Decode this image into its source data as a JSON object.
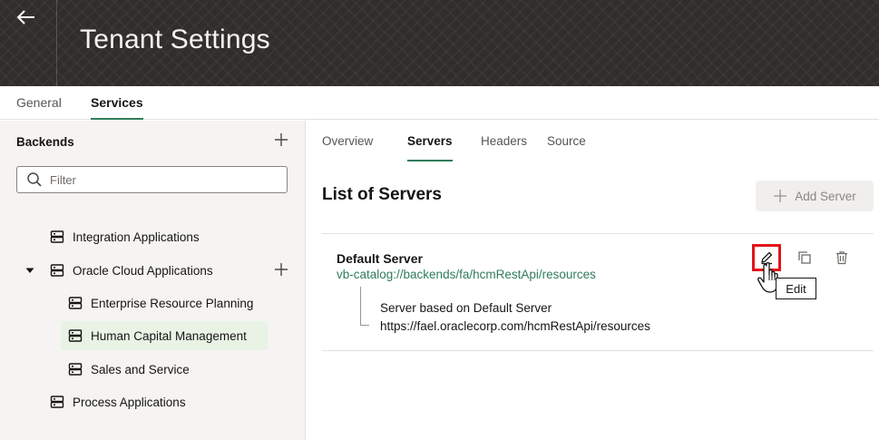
{
  "header": {
    "title": "Tenant Settings",
    "background": "#312d2a"
  },
  "top_tabs": [
    {
      "label": "General",
      "active": false
    },
    {
      "label": "Services",
      "active": true
    }
  ],
  "backends": {
    "title": "Backends",
    "filter_placeholder": "Filter",
    "items": [
      {
        "label": "Integration Applications",
        "level": 0,
        "expandable": false,
        "selected": false,
        "icon": "server-stack-icon"
      },
      {
        "label": "Oracle Cloud Applications",
        "level": 0,
        "expandable": true,
        "expanded": true,
        "selected": false,
        "icon": "server-stack-icon"
      },
      {
        "label": "Enterprise Resource Planning",
        "level": 1,
        "selected": false,
        "icon": "server-stack-icon"
      },
      {
        "label": "Human Capital Management",
        "level": 1,
        "selected": true,
        "icon": "server-stack-icon"
      },
      {
        "label": "Sales and Service",
        "level": 1,
        "selected": false,
        "icon": "server-stack-icon"
      },
      {
        "label": "Process Applications",
        "level": 0,
        "expandable": false,
        "selected": false,
        "icon": "server-stack-icon"
      }
    ]
  },
  "sub_tabs": [
    {
      "label": "Overview",
      "active": false
    },
    {
      "label": "Servers",
      "active": true
    },
    {
      "label": "Headers",
      "active": false
    },
    {
      "label": "Source",
      "active": false
    }
  ],
  "servers": {
    "title": "List of Servers",
    "add_label": "Add Server",
    "items": [
      {
        "name": "Default Server",
        "url": "vb-catalog://backends/fa/hcmRestApi/resources",
        "description": "Server based on Default Server",
        "resolved_url": "https://fael.oraclecorp.com/hcmRestApi/resources"
      }
    ],
    "tooltip": "Edit"
  },
  "colors": {
    "accent": "#2f7d5c",
    "highlight": "#e3141b",
    "selected_bg": "#e8f3e6"
  }
}
